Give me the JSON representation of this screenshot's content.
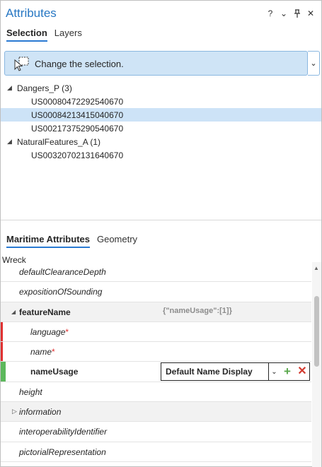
{
  "window": {
    "title": "Attributes",
    "buttons": [
      "?",
      "⌄",
      "⊥",
      "✕"
    ]
  },
  "top_tabs": [
    {
      "label": "Selection",
      "active": true
    },
    {
      "label": "Layers",
      "active": false
    }
  ],
  "banner": {
    "text": "Change the selection.",
    "icon": "select-cursor-icon"
  },
  "tree": {
    "groups": [
      {
        "label": "Dangers_P (3)",
        "items": [
          "US00080472292540670",
          "US00084213415040670",
          "US00217375290540670"
        ],
        "selected_index": 1
      },
      {
        "label": "NaturalFeatures_A (1)",
        "items": [
          "US00320702131640670"
        ],
        "selected_index": -1
      }
    ]
  },
  "bottom_tabs": [
    {
      "label": "Maritime Attributes",
      "active": true
    },
    {
      "label": "Geometry",
      "active": false
    }
  ],
  "subject": "Wreck",
  "attributes": {
    "rows": [
      {
        "name": "defaultClearanceDepth",
        "indent": 0
      },
      {
        "name": "expositionOfSounding",
        "indent": 0
      },
      {
        "name": "featureName",
        "indent": 0,
        "value": "{\"nameUsage\":[1]}"
      },
      {
        "name": "language",
        "indent": 1,
        "required": "*"
      },
      {
        "name": "name",
        "indent": 1,
        "required": "*"
      },
      {
        "name": "nameUsage",
        "indent": 1
      },
      {
        "name": "height",
        "indent": 0
      },
      {
        "name": "information",
        "indent": 0
      },
      {
        "name": "interoperabilityIdentifier",
        "indent": 0
      },
      {
        "name": "pictorialRepresentation",
        "indent": 0
      }
    ],
    "name_usage_value": "Default Name Display"
  },
  "colors": {
    "accent": "#2a7ad2",
    "selection": "#cde3f7",
    "banner": "#cfe4f6",
    "required_marker": "#e03030",
    "valid_marker": "#5cb85c",
    "add": "#5aa84c",
    "delete": "#d23a2f"
  }
}
